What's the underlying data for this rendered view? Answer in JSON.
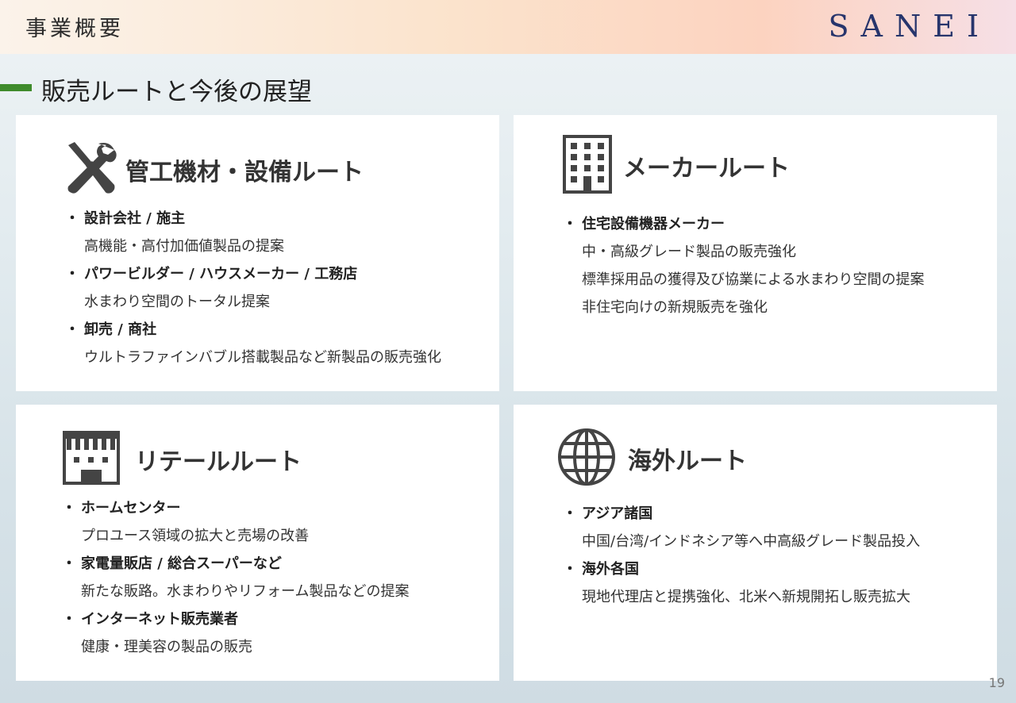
{
  "header": {
    "title": "事業概要",
    "logo": "SANEI"
  },
  "section": {
    "title": "販売ルートと今後の展望"
  },
  "cards": [
    {
      "icon": "tools-icon",
      "title": "管工機材・設備ルート",
      "items": [
        {
          "bullet": "・",
          "head": "設計会社 / 施主",
          "lines": [
            "高機能・高付加価値製品の提案"
          ]
        },
        {
          "bullet": "・",
          "head": "パワービルダー / ハウスメーカー / 工務店",
          "lines": [
            "水まわり空間のトータル提案"
          ]
        },
        {
          "bullet": "・",
          "head": "卸売 / 商社",
          "lines": [
            "ウルトラファインバブル搭載製品など新製品の販売強化"
          ]
        }
      ]
    },
    {
      "icon": "building-icon",
      "title": "メーカールート",
      "items": [
        {
          "bullet": "・",
          "head": "住宅設備機器メーカー",
          "lines": [
            "中・高級グレード製品の販売強化",
            "標準採用品の獲得及び協業による水まわり空間の提案",
            "非住宅向けの新規販売を強化"
          ]
        }
      ]
    },
    {
      "icon": "store-icon",
      "title": "リテールルート",
      "items": [
        {
          "bullet": "・",
          "head": "ホームセンター",
          "lines": [
            "プロユース領域の拡大と売場の改善"
          ]
        },
        {
          "bullet": "・",
          "head": "家電量販店 / 総合スーパーなど",
          "lines": [
            "新たな販路。水まわりやリフォーム製品などの提案"
          ]
        },
        {
          "bullet": "・",
          "head": "インターネット販売業者",
          "lines": [
            "健康・理美容の製品の販売"
          ]
        }
      ]
    },
    {
      "icon": "globe-icon",
      "title": "海外ルート",
      "items": [
        {
          "bullet": "・",
          "head": "アジア諸国",
          "lines": [
            "中国/台湾/インドネシア等へ中高級グレード製品投入"
          ]
        },
        {
          "bullet": "・",
          "head": "海外各国",
          "lines": [
            "現地代理店と提携強化、北米へ新規開拓し販売拡大"
          ]
        }
      ]
    }
  ],
  "page_number": "19"
}
